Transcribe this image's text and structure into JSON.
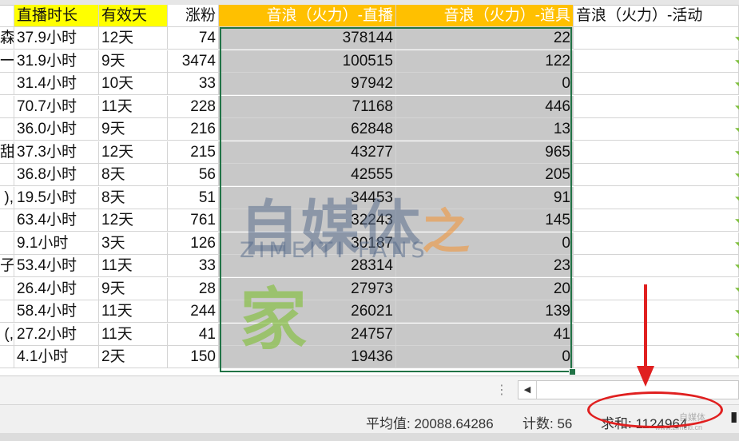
{
  "sheet": {
    "headers": {
      "c1": "直播时长",
      "c2": "有效天",
      "c3": "涨粉",
      "c4": "音浪（火力）-直播",
      "c5": "音浪（火力）-道具",
      "c6": "音浪（火力）-活动"
    },
    "rows": [
      {
        "c0": "森",
        "c1": "37.9小时",
        "c2": "12天",
        "c3": "74",
        "c4": "378144",
        "c5": "22"
      },
      {
        "c0": "一",
        "c1": "31.9小时",
        "c2": "9天",
        "c3": "3474",
        "c4": "100515",
        "c5": "122"
      },
      {
        "c0": "",
        "c1": "31.4小时",
        "c2": "10天",
        "c3": "33",
        "c4": "97942",
        "c5": "0"
      },
      {
        "c0": "",
        "c1": "70.7小时",
        "c2": "11天",
        "c3": "228",
        "c4": "71168",
        "c5": "446"
      },
      {
        "c0": "",
        "c1": "36.0小时",
        "c2": "9天",
        "c3": "216",
        "c4": "62848",
        "c5": "13"
      },
      {
        "c0": "甜",
        "c1": "37.3小时",
        "c2": "12天",
        "c3": "215",
        "c4": "43277",
        "c5": "965"
      },
      {
        "c0": "",
        "c1": "36.8小时",
        "c2": "8天",
        "c3": "56",
        "c4": "42555",
        "c5": "205"
      },
      {
        "c0": "),",
        "c1": "19.5小时",
        "c2": "8天",
        "c3": "51",
        "c4": "34453",
        "c5": "91"
      },
      {
        "c0": "",
        "c1": "63.4小时",
        "c2": "12天",
        "c3": "761",
        "c4": "32243",
        "c5": "145"
      },
      {
        "c0": "",
        "c1": "9.1小时",
        "c2": "3天",
        "c3": "126",
        "c4": "30187",
        "c5": "0"
      },
      {
        "c0": "子",
        "c1": "53.4小时",
        "c2": "11天",
        "c3": "33",
        "c4": "28314",
        "c5": "23"
      },
      {
        "c0": "",
        "c1": "26.4小时",
        "c2": "9天",
        "c3": "28",
        "c4": "27973",
        "c5": "20"
      },
      {
        "c0": "",
        "c1": "58.4小时",
        "c2": "11天",
        "c3": "244",
        "c4": "26021",
        "c5": "139"
      },
      {
        "c0": "(,",
        "c1": "27.2小时",
        "c2": "11天",
        "c3": "41",
        "c4": "24757",
        "c5": "41"
      },
      {
        "c0": "",
        "c1": "4.1小时",
        "c2": "2天",
        "c3": "150",
        "c4": "19436",
        "c5": "0"
      }
    ]
  },
  "watermark": {
    "cn_a": "自媒体",
    "cn_b": "之",
    "cn_c": "家",
    "en": "ZIMEITI FANS"
  },
  "status_bar": {
    "average": "平均值: 20088.64286",
    "count": "计数: 56",
    "sum": "求和: 1124964"
  },
  "corner_watermark": {
    "line1": "自媒体",
    "line2": "www.zimeiti.cn"
  },
  "colors": {
    "yellow_header": "#ffff00",
    "orange_header": "#ffc000",
    "selection": "#c8c8c8",
    "selection_border": "#217346",
    "annotation_red": "#e02020"
  }
}
